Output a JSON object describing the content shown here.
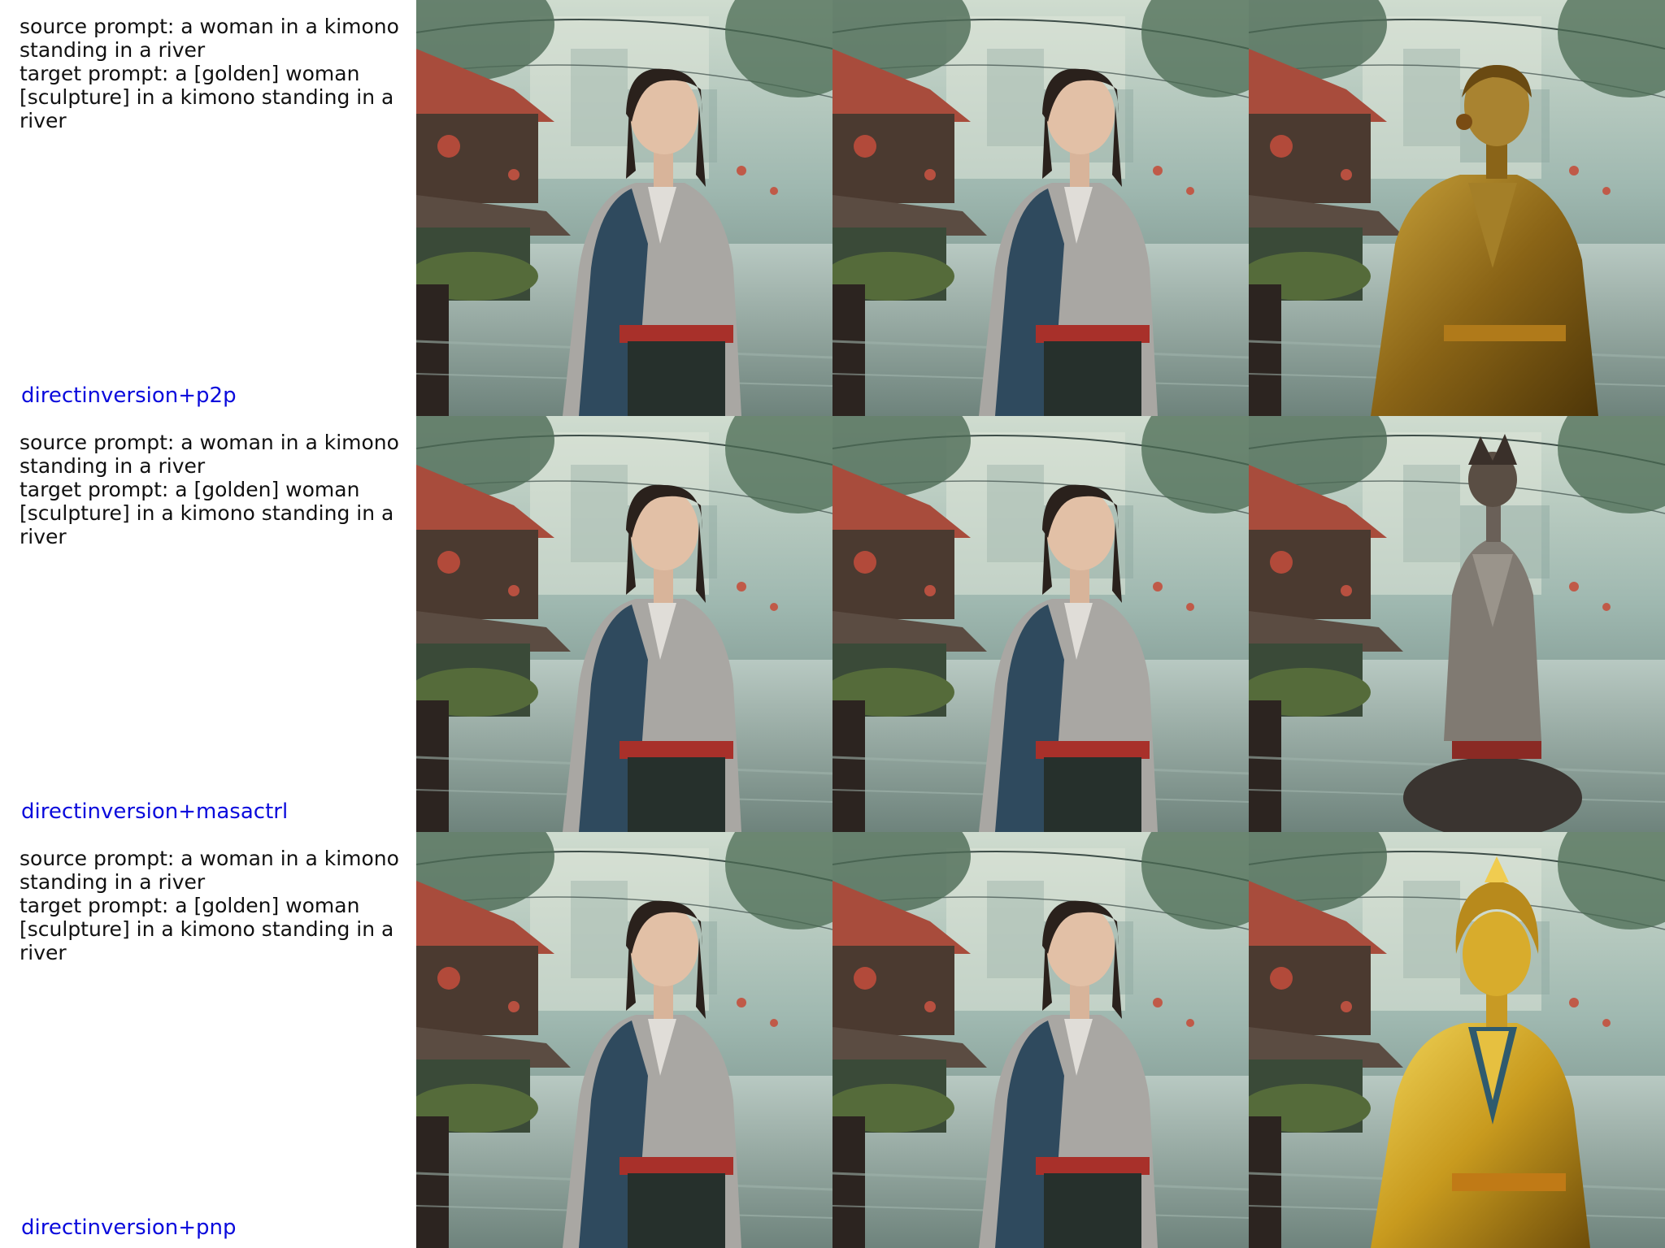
{
  "method_color": "#0a0adc",
  "rows": [
    {
      "source_prompt": "source prompt: a woman in a kimono standing in a river",
      "target_prompt": "target prompt: a [golden] woman [sculpture] in a kimono standing in a river",
      "method": "directinversion+p2p",
      "tiles": [
        "source-image",
        "reconstruction-image",
        "edited-image"
      ],
      "edit_style": "gold"
    },
    {
      "source_prompt": "source prompt: a woman in a kimono standing in a river",
      "target_prompt": "target prompt: a [golden] woman [sculpture] in a kimono standing in a river",
      "method": "directinversion+masactrl",
      "tiles": [
        "source-image",
        "reconstruction-image",
        "edited-image"
      ],
      "edit_style": "stone-statue"
    },
    {
      "source_prompt": "source prompt: a woman in a kimono standing in a river",
      "target_prompt": "target prompt: a [golden] woman [sculpture] in a kimono standing in a river",
      "method": "directinversion+pnp",
      "tiles": [
        "source-image",
        "reconstruction-image",
        "edited-image"
      ],
      "edit_style": "bright-gold"
    }
  ]
}
